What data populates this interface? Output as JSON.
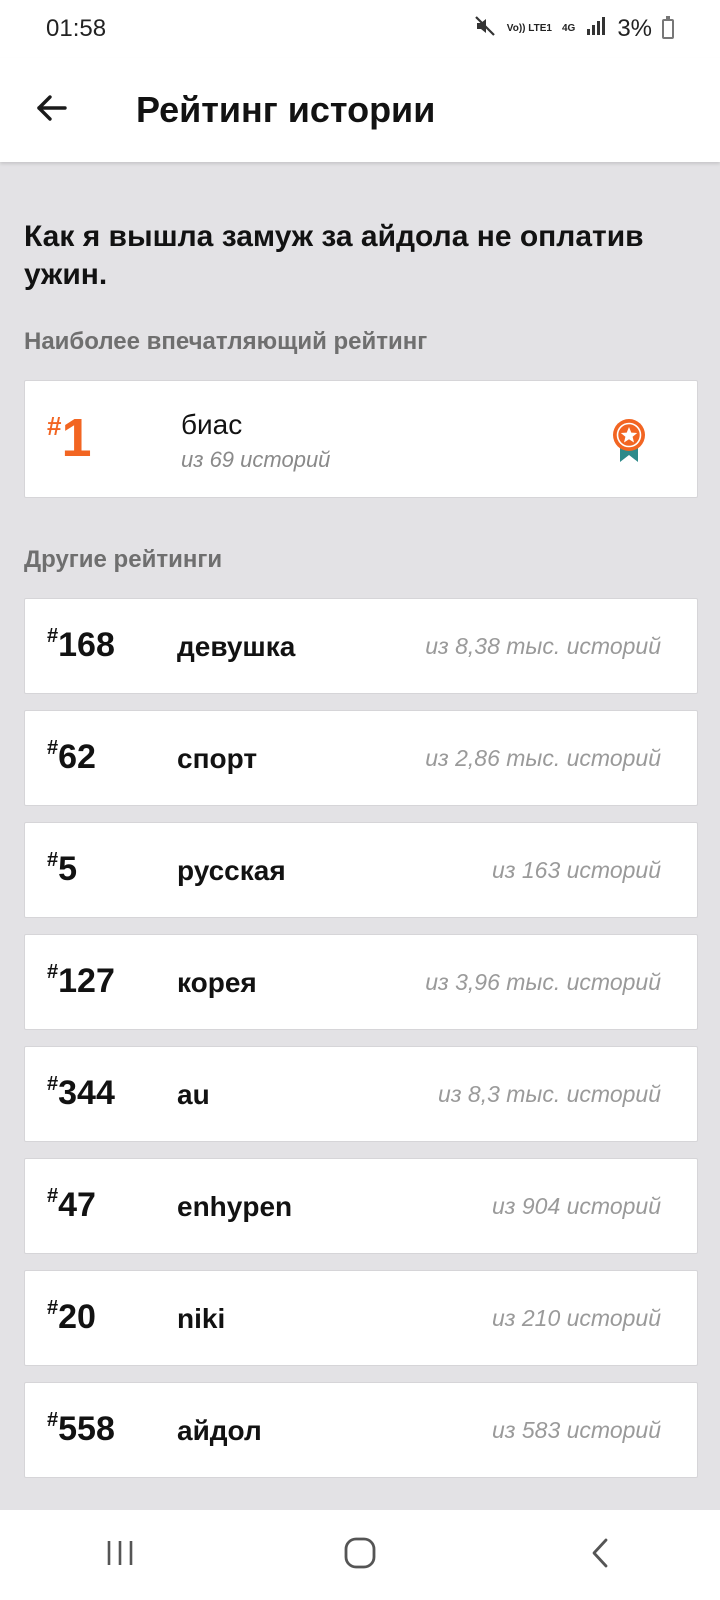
{
  "status_bar": {
    "time": "01:58",
    "volte_label": "Vo)) LTE1",
    "network_label": "4G",
    "battery_percent": "3%"
  },
  "app_bar": {
    "title": "Рейтинг истории"
  },
  "story": {
    "title": "Как я вышла замуж за айдола не оплатив ужин."
  },
  "top_section": {
    "label": "Наиболее впечатляющий рейтинг",
    "rank_hash": "#",
    "rank": "1",
    "tag": "биас",
    "subtitle": "из 69 историй",
    "accent_color": "#f26522",
    "medal_icon": "medal-icon"
  },
  "other_section": {
    "label": "Другие рейтинги",
    "items": [
      {
        "hash": "#",
        "rank": "168",
        "tag": "девушка",
        "count": "из 8,38 тыс. историй"
      },
      {
        "hash": "#",
        "rank": "62",
        "tag": "спорт",
        "count": "из 2,86 тыс. историй"
      },
      {
        "hash": "#",
        "rank": "5",
        "tag": "русская",
        "count": "из 163 историй"
      },
      {
        "hash": "#",
        "rank": "127",
        "tag": "корея",
        "count": "из 3,96 тыс. историй"
      },
      {
        "hash": "#",
        "rank": "344",
        "tag": "au",
        "count": "из 8,3 тыс. историй"
      },
      {
        "hash": "#",
        "rank": "47",
        "tag": "enhypen",
        "count": "из 904 историй"
      },
      {
        "hash": "#",
        "rank": "20",
        "tag": "niki",
        "count": "из 210 историй"
      },
      {
        "hash": "#",
        "rank": "558",
        "tag": "айдол",
        "count": "из 583 историй"
      }
    ]
  },
  "nav_bar": {
    "recent_icon": "recent-apps-icon",
    "home_icon": "home-icon",
    "back_icon": "back-chevron-icon"
  }
}
